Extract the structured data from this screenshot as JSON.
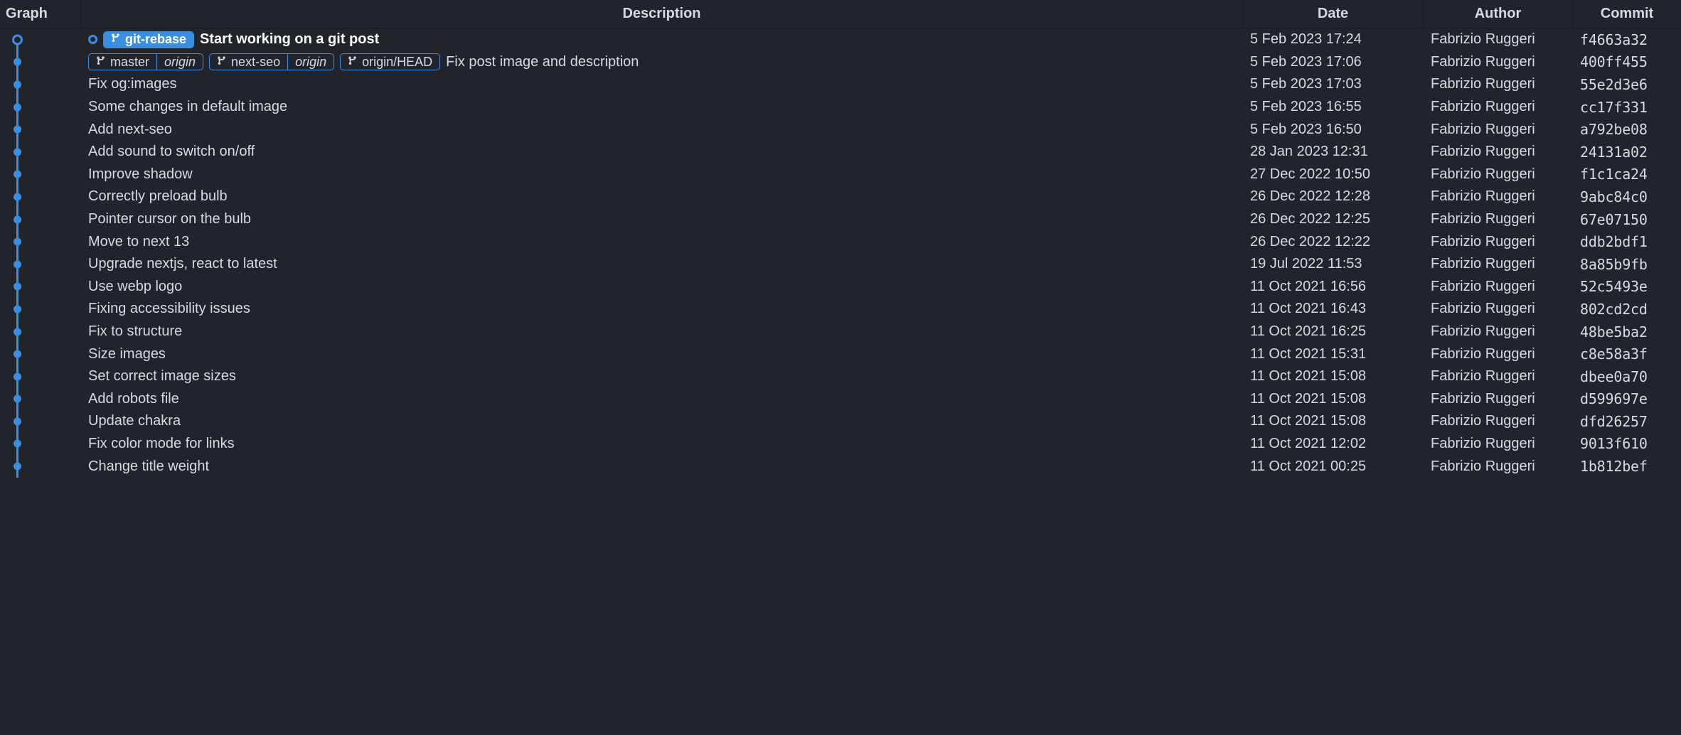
{
  "columns": {
    "graph": "Graph",
    "description": "Description",
    "date": "Date",
    "author": "Author",
    "commit": "Commit"
  },
  "colors": {
    "branch": "#3a8fe0",
    "bg": "#21252b",
    "text": "#d7dae0"
  },
  "commits": [
    {
      "current": true,
      "bold": true,
      "refs": [
        {
          "segments": [
            {
              "icon": true,
              "filled": true,
              "label": "git-rebase"
            }
          ]
        }
      ],
      "message": "Start working on a git post",
      "date": "5 Feb 2023 17:24",
      "author": "Fabrizio Ruggeri",
      "hash": "f4663a32"
    },
    {
      "refs": [
        {
          "segments": [
            {
              "icon": true,
              "label": "master"
            },
            {
              "remote": true,
              "label": "origin"
            }
          ]
        },
        {
          "segments": [
            {
              "icon": true,
              "label": "next-seo"
            },
            {
              "remote": true,
              "label": "origin"
            }
          ]
        },
        {
          "segments": [
            {
              "icon": true,
              "label": "origin/HEAD"
            }
          ]
        }
      ],
      "message": "Fix post image and description",
      "date": "5 Feb 2023 17:06",
      "author": "Fabrizio Ruggeri",
      "hash": "400ff455"
    },
    {
      "message": "Fix og:images",
      "date": "5 Feb 2023 17:03",
      "author": "Fabrizio Ruggeri",
      "hash": "55e2d3e6"
    },
    {
      "message": "Some changes in default image",
      "date": "5 Feb 2023 16:55",
      "author": "Fabrizio Ruggeri",
      "hash": "cc17f331"
    },
    {
      "message": "Add next-seo",
      "date": "5 Feb 2023 16:50",
      "author": "Fabrizio Ruggeri",
      "hash": "a792be08"
    },
    {
      "message": "Add sound to switch on/off",
      "date": "28 Jan 2023 12:31",
      "author": "Fabrizio Ruggeri",
      "hash": "24131a02"
    },
    {
      "message": "Improve shadow",
      "date": "27 Dec 2022 10:50",
      "author": "Fabrizio Ruggeri",
      "hash": "f1c1ca24"
    },
    {
      "message": "Correctly preload bulb",
      "date": "26 Dec 2022 12:28",
      "author": "Fabrizio Ruggeri",
      "hash": "9abc84c0"
    },
    {
      "message": "Pointer cursor on the bulb",
      "date": "26 Dec 2022 12:25",
      "author": "Fabrizio Ruggeri",
      "hash": "67e07150"
    },
    {
      "message": "Move to next 13",
      "date": "26 Dec 2022 12:22",
      "author": "Fabrizio Ruggeri",
      "hash": "ddb2bdf1"
    },
    {
      "message": "Upgrade nextjs, react to latest",
      "date": "19 Jul 2022 11:53",
      "author": "Fabrizio Ruggeri",
      "hash": "8a85b9fb"
    },
    {
      "message": "Use webp logo",
      "date": "11 Oct 2021 16:56",
      "author": "Fabrizio Ruggeri",
      "hash": "52c5493e"
    },
    {
      "message": "Fixing accessibility issues",
      "date": "11 Oct 2021 16:43",
      "author": "Fabrizio Ruggeri",
      "hash": "802cd2cd"
    },
    {
      "message": "Fix to structure",
      "date": "11 Oct 2021 16:25",
      "author": "Fabrizio Ruggeri",
      "hash": "48be5ba2"
    },
    {
      "message": "Size images",
      "date": "11 Oct 2021 15:31",
      "author": "Fabrizio Ruggeri",
      "hash": "c8e58a3f"
    },
    {
      "message": "Set correct image sizes",
      "date": "11 Oct 2021 15:08",
      "author": "Fabrizio Ruggeri",
      "hash": "dbee0a70"
    },
    {
      "message": "Add robots file",
      "date": "11 Oct 2021 15:08",
      "author": "Fabrizio Ruggeri",
      "hash": "d599697e"
    },
    {
      "message": "Update chakra",
      "date": "11 Oct 2021 15:08",
      "author": "Fabrizio Ruggeri",
      "hash": "dfd26257"
    },
    {
      "message": "Fix color mode for links",
      "date": "11 Oct 2021 12:02",
      "author": "Fabrizio Ruggeri",
      "hash": "9013f610"
    },
    {
      "message": "Change title weight",
      "date": "11 Oct 2021 00:25",
      "author": "Fabrizio Ruggeri",
      "hash": "1b812bef"
    }
  ]
}
